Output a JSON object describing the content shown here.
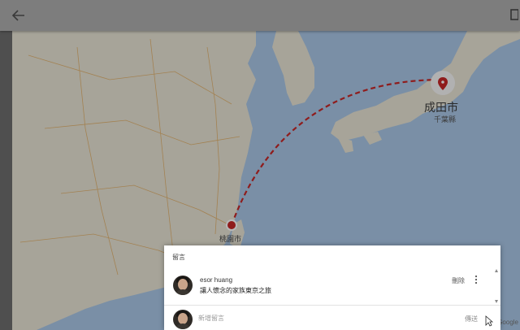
{
  "topbar": {
    "back_icon": "arrow-left-icon",
    "right_icon": "rectangle-icon"
  },
  "map": {
    "destination": {
      "name": "成田市",
      "region": "千葉縣"
    },
    "origin": {
      "name": "桃園市"
    },
    "attribution": "Google"
  },
  "comments": {
    "title": "留言",
    "items": [
      {
        "author": "esor huang",
        "text": "讓人懷念的家族東京之旅",
        "delete_label": "刪除"
      }
    ],
    "compose": {
      "placeholder": "新增留言",
      "send_label": "傳送"
    }
  },
  "colors": {
    "route": "#c62828",
    "pin": "#c62828"
  }
}
